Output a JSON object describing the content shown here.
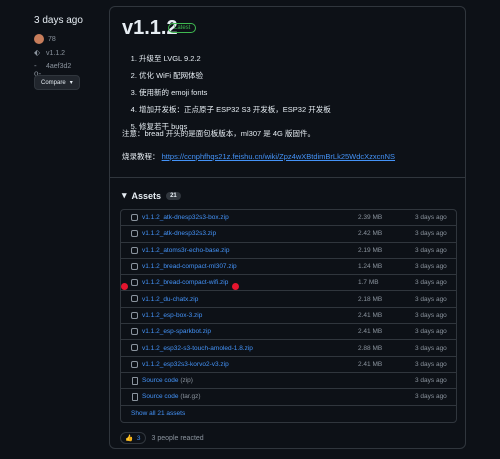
{
  "release": {
    "date": "3 days ago",
    "author": "78",
    "tag": "v1.1.2",
    "commit": "4aef3d2",
    "compare_label": "Compare",
    "title": "v1.1.2",
    "latest_badge": "Latest",
    "notes": [
      "升级至 LVGL 9.2.2",
      "优化 WiFi 配网体验",
      "使用新的 emoji fonts",
      "增加开发板：正点原子 ESP32 S3 开发板，ESP32 开发板",
      "修复若干 bugs"
    ],
    "note_text": "注意：bread 开头的是面包板版本，ml307 是 4G 版固件。",
    "flash_label": "烧录教程：",
    "flash_link": "https://ccnphfhqs21z.feishu.cn/wiki/Zpz4wXBtdimBrLk25WdcXzxcnNS"
  },
  "assets": {
    "heading": "Assets",
    "count": "21",
    "items": [
      {
        "name": "v1.1.2_atk-dnesp32s3-box.zip",
        "size": "2.39 MB",
        "age": "3 days ago"
      },
      {
        "name": "v1.1.2_atk-dnesp32s3.zip",
        "size": "2.42 MB",
        "age": "3 days ago"
      },
      {
        "name": "v1.1.2_atoms3r-echo-base.zip",
        "size": "2.19 MB",
        "age": "3 days ago"
      },
      {
        "name": "v1.1.2_bread-compact-ml307.zip",
        "size": "1.24 MB",
        "age": "3 days ago"
      },
      {
        "name": "v1.1.2_bread-compact-wifi.zip",
        "size": "1.7 MB",
        "age": "3 days ago"
      },
      {
        "name": "v1.1.2_du-chatx.zip",
        "size": "2.18 MB",
        "age": "3 days ago"
      },
      {
        "name": "v1.1.2_esp-box-3.zip",
        "size": "2.41 MB",
        "age": "3 days ago"
      },
      {
        "name": "v1.1.2_esp-sparkbot.zip",
        "size": "2.41 MB",
        "age": "3 days ago"
      },
      {
        "name": "v1.1.2_esp32-s3-touch-amoled-1.8.zip",
        "size": "2.88 MB",
        "age": "3 days ago"
      },
      {
        "name": "v1.1.2_esp32s3-korvo2-v3.zip",
        "size": "2.41 MB",
        "age": "3 days ago"
      }
    ],
    "sources": [
      {
        "label": "Source code",
        "ext": "(zip)",
        "age": "3 days ago"
      },
      {
        "label": "Source code",
        "ext": "(tar.gz)",
        "age": "3 days ago"
      }
    ],
    "show_all": "Show all 21 assets"
  },
  "reactions": {
    "emoji": "👍",
    "count": "3",
    "text": "3 people reacted"
  },
  "colors": {
    "background": "#0d1117",
    "link": "#4493f8",
    "latest": "#3fb950",
    "marker": "#e5152e"
  },
  "icons": [
    "tag-icon",
    "commit-icon",
    "package-icon",
    "file-zip-icon",
    "triangle-down-icon",
    "thumbs-up-icon"
  ]
}
